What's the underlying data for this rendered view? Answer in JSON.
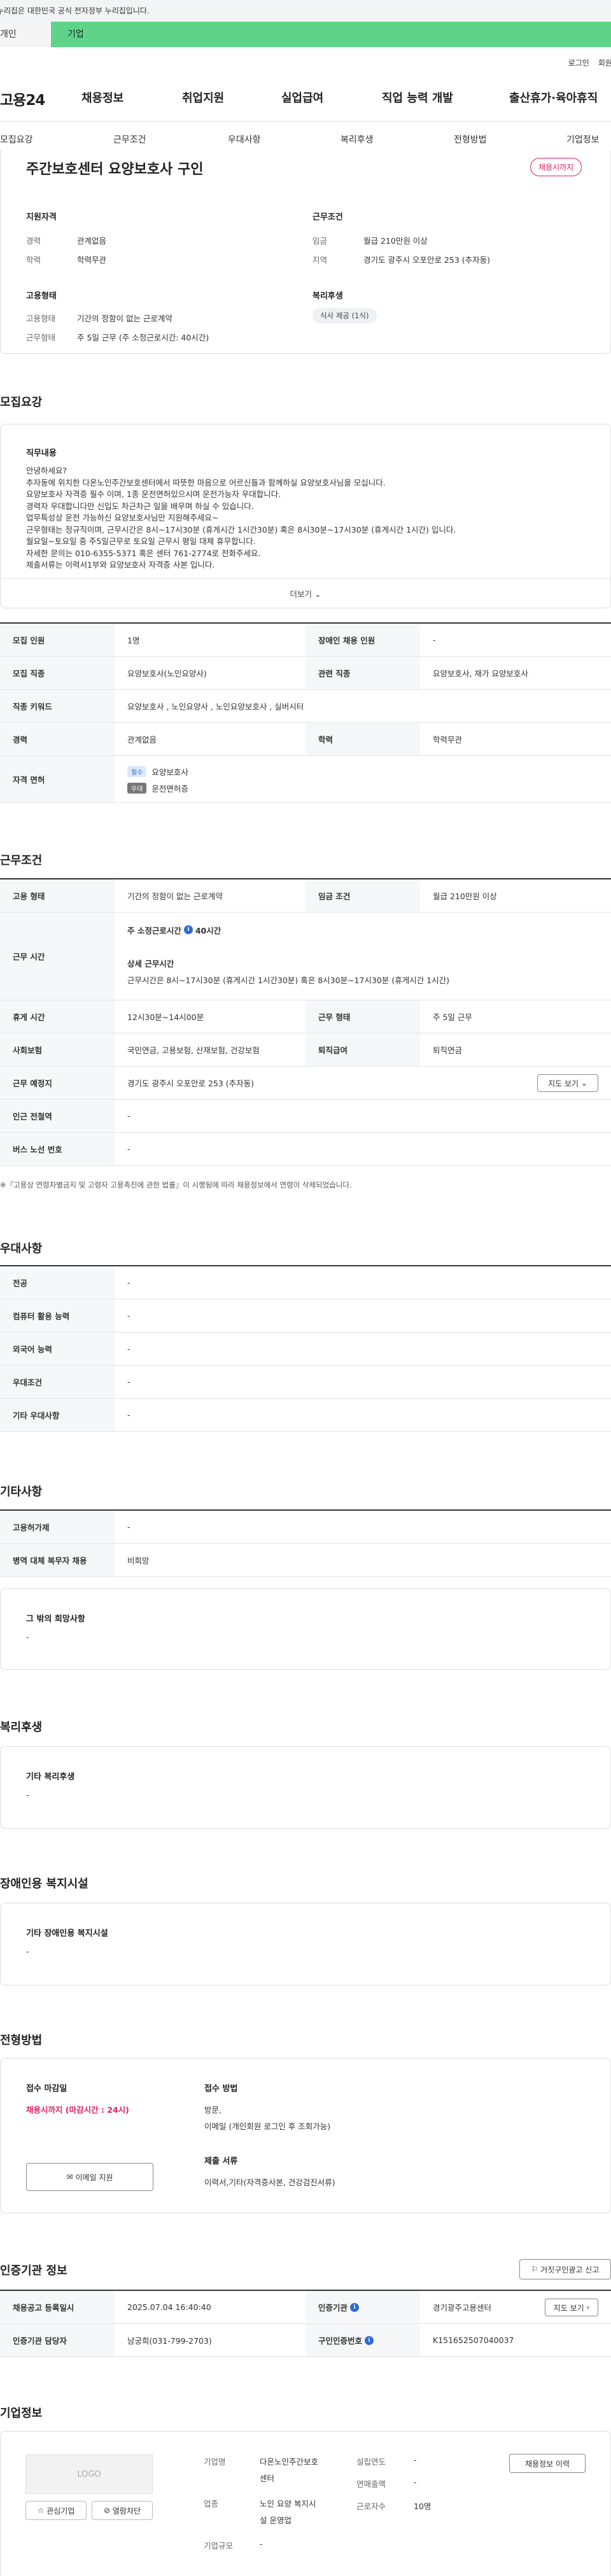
{
  "gov_banner": "이 누리집은 대한민국 공식 전자정부 누리집입니다.",
  "user_tabs": [
    "개인",
    "기업"
  ],
  "top_links": [
    "로그인",
    "회원가입"
  ],
  "logo": "고용24",
  "gnb": [
    "채용정보",
    "취업지원",
    "실업급여",
    "직업 능력 개발",
    "출산휴가·육아휴직"
  ],
  "subnav": [
    "모집요강",
    "근무조건",
    "우대사항",
    "복리후생",
    "전형방법",
    "기업정보"
  ],
  "job": {
    "title": "주간보호센터 요양보호사 구인",
    "status_badge": "채용시까지",
    "qual_head": "지원자격",
    "career_label": "경력",
    "career_value": "관계없음",
    "edu_label": "학력",
    "edu_value": "학력무관",
    "cond_head": "근무조건",
    "wage_label": "임금",
    "wage_value": "월급 210만원 이상",
    "area_label": "지역",
    "area_value": "경기도 광주시 오포안로 253 (추자동)",
    "type_head": "고용형태",
    "emp_label": "고용형태",
    "emp_value": "기간의 정함이 없는 근로계약",
    "work_label": "근무형태",
    "work_value": "주 5일 근무 (주 소정근로시간: 40시간)",
    "benefit_head": "복리후생",
    "benefit_chip": "식사 제공 (1식)"
  },
  "recruit": {
    "section_title": "모집요강",
    "desc_head": "직무내용",
    "desc_text": "안녕하세요?\n추자동에 위치한 다온노인주간보호센터에서 따뜻한 마음으로 어르신들과 함께하실 요양보호사님을 모십니다.\n요양보호사 자격증 필수 이며, 1종 운전면허있으시며 운전가능자 우대합니다.\n경력자 우대합니다만 신입도 차근차근 일을 배우며 하실 수 있습니다.\n업무특성상 운전 가능하신 요양보호사님만 지원해주세요~\n근무형태는 정규직이며, 근무시간은 8시~17시30분 (휴게시간 1시간30분) 혹은 8시30분~17시30분 (휴게시간 1시간) 입니다.\n월요일~토요일 중 주5일근무로 토요일 근무시 평일 대체 휴무합니다.\n자세한 문의는 010-6355-5371 혹은 센터 761-2774로 전화주세요.\n제출서류는 이력서1부와 요양보호사 자격증 사본 입니다.",
    "more": "더보기",
    "rows": [
      {
        "th1": "모집 인원",
        "td1": "1명",
        "th2": "장애인 채용 인원",
        "td2": "-"
      },
      {
        "th1": "모집 직종",
        "td1": "요양보호사(노인요양사)",
        "th2": "관련 직종",
        "td2": "요양보호사, 재가 요양보호사"
      },
      {
        "th1": "직종 키워드",
        "td1": "요양보호사 , 노인요양사 , 노인요양보호사 , 실버시터"
      },
      {
        "th1": "경력",
        "td1": "관계없음",
        "th2": "학력",
        "td2": "학력무관"
      }
    ],
    "license_th": "자격 면허",
    "license_tag1": "필수",
    "license_val1": "요양보호사",
    "license_tag2": "우대",
    "license_val2": "운전면허증"
  },
  "work": {
    "section_title": "근무조건",
    "emp_th": "고용 형태",
    "emp_td": "기간의 정함이 없는 근로계약",
    "wage_th": "임금 조건",
    "wage_td": "월급 210만원 이상",
    "hours_th": "근무 시간",
    "hours_line1": "주 소정근로시간",
    "hours_value": "40시간",
    "hours_detail_head": "상세 근무시간",
    "hours_detail": "근무시간은 8시~17시30분 (휴게시간 1시간30분) 혹은 8시30분~17시30분 (휴게시간 1시간)",
    "rest_th": "휴게 시간",
    "rest_td": "12시30분~14시00분",
    "type_th": "근무 형태",
    "type_td": "주 5일 근무",
    "ins_th": "사회보험",
    "ins_td": "국민연금, 고용보험, 산재보험, 건강보험",
    "sev_th": "퇴직급여",
    "sev_td": "퇴직연금",
    "place_th": "근무 예정지",
    "place_td": "경기도 광주시 오포안로 253 (추자동)",
    "map_btn": "지도 보기",
    "sub_th": "인근 전철역",
    "sub_td": "-",
    "bus_th": "버스 노선 번호",
    "bus_td": "-",
    "note": "※『고용상 연령차별금지 및 고령자 고용촉진에 관한 법률』이 시행됨에 따라 채용정보에서 연령이 삭제되었습니다."
  },
  "pref": {
    "section_title": "우대사항",
    "rows": [
      {
        "th": "전공",
        "td": "-"
      },
      {
        "th": "컴퓨터 활용 능력",
        "td": "-"
      },
      {
        "th": "외국어 능력",
        "td": "-"
      },
      {
        "th": "우대조건",
        "td": "-"
      },
      {
        "th": "기타 우대사항",
        "td": "-"
      }
    ]
  },
  "etc": {
    "section_title": "기타사항",
    "rows": [
      {
        "th": "고용허가제",
        "td": "-"
      },
      {
        "th": "병역 대체 복무자 채용",
        "td": "비희망"
      }
    ],
    "other_head": "그 밖의 희망사항",
    "other_value": "-"
  },
  "welfare": {
    "section_title": "복리후생",
    "head": "기타 복리후생",
    "value": "-"
  },
  "disability": {
    "section_title": "장애인용 복지시설",
    "head": "기타 장애인용 복지시설",
    "value": "-"
  },
  "selection": {
    "section_title": "전형방법",
    "deadline_head": "접수 마감일",
    "deadline_value": "채용시까지 (마감시간 : 24시)",
    "email_btn": "이메일 지원",
    "method_head": "접수 방법",
    "method_value1": "방문,",
    "method_value2": "이메일 (개인회원 로그인 후 조회가능)",
    "docs_head": "제출 서류",
    "docs_value": "이력서,기타(자격증사본, 건강검진서류)"
  },
  "agency": {
    "section_title": "인증기관 정보",
    "report_btn": "거짓구인광고 신고",
    "reg_th": "채용공고 등록일시",
    "reg_td": "2025.07.04 16:40:40",
    "org_th": "인증기관",
    "org_td": "경기광주고용센터",
    "map_btn": "지도 보기",
    "mgr_th": "인증기관 담당자",
    "mgr_td": "남궁희(031-799-2703)",
    "num_th": "구인인증번호",
    "num_td": "K151652507040037"
  },
  "company": {
    "section_title": "기업정보",
    "logo_text": "LOGO",
    "fav_btn": "관심기업",
    "block_btn": "열람차단",
    "info_btn": "채용정보 이력",
    "name_label": "기업명",
    "name_value1": "다온노인주간보호",
    "name_value2": "센터",
    "biz_label": "업종",
    "biz_value1": "노인 요양 복지시",
    "biz_value2": "설 운영업",
    "scale_label": "기업규모",
    "scale_value": "-",
    "year_label": "설립연도",
    "year_value": "-",
    "sales_label": "연매출액",
    "sales_value": "-",
    "emp_label": "근로자수",
    "emp_value": "10명"
  }
}
